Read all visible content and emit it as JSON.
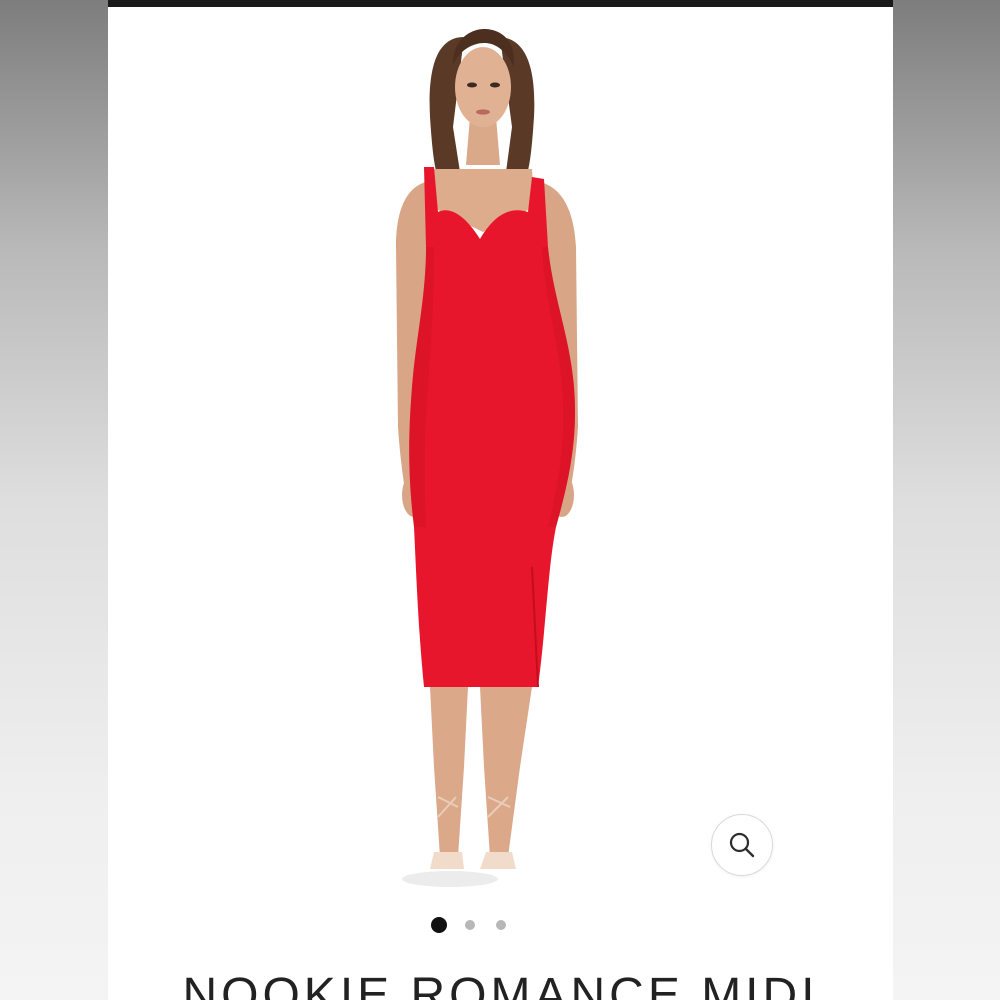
{
  "product": {
    "title": "NOOKIE ROMANCE MIDI",
    "image_alt": "Model wearing red sweetheart-neck midi dress",
    "dress_color": "#e8162c"
  },
  "gallery": {
    "zoom_icon": "magnifier-icon",
    "slide_count": 3,
    "active_slide": 1
  }
}
